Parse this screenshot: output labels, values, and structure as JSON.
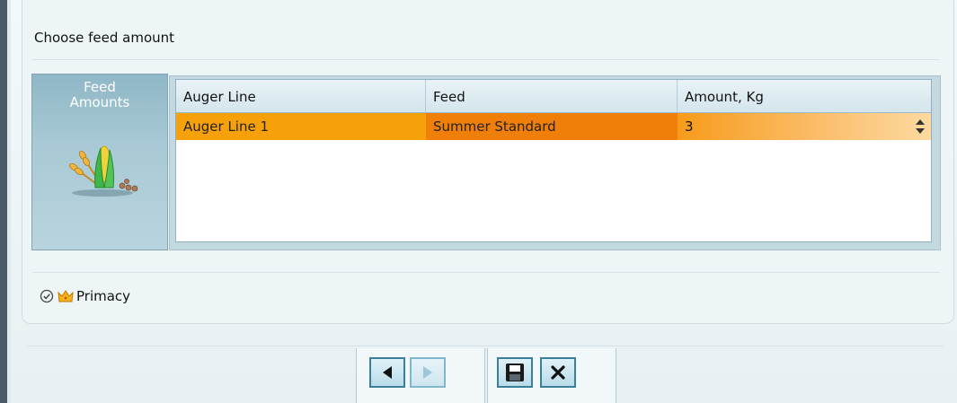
{
  "title": "Choose feed amount",
  "feed_card": {
    "title": "Feed Amounts",
    "icon": "wheat-corn-icon"
  },
  "grid": {
    "columns": [
      "Auger Line",
      "Feed",
      "Amount, Kg"
    ],
    "rows": [
      {
        "auger_line": "Auger Line 1",
        "feed": "Summer Standard",
        "amount": "3"
      }
    ]
  },
  "primacy": {
    "label": "Primacy",
    "icons": [
      "check-circle-icon",
      "crown-icon"
    ]
  },
  "toolbar": {
    "buttons": [
      {
        "name": "back-button",
        "icon": "arrow-left-icon",
        "enabled": true
      },
      {
        "name": "next-button",
        "icon": "arrow-right-icon",
        "enabled": false
      },
      {
        "name": "save-button",
        "icon": "floppy-disk-icon",
        "enabled": true
      },
      {
        "name": "cancel-button",
        "icon": "close-icon",
        "enabled": true
      }
    ]
  },
  "colors": {
    "selected_row_1": "#f7a10a",
    "selected_row_2": "#f07f0a",
    "accent": "#3a7f98"
  }
}
